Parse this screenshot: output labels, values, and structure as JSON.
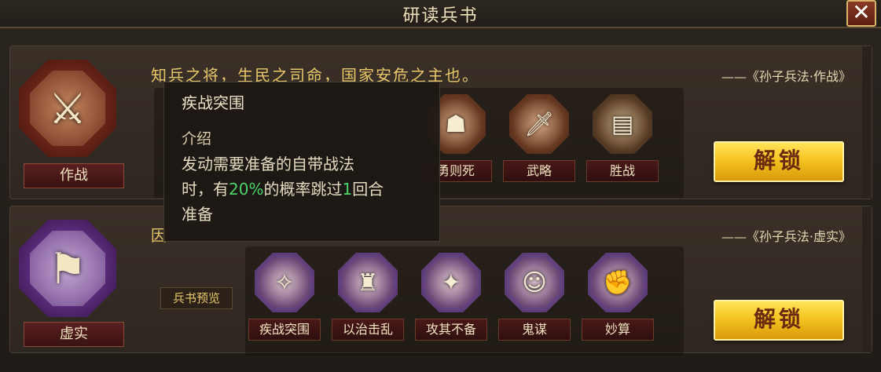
{
  "window": {
    "title": "研读兵书",
    "close_label": "✕"
  },
  "colors": {
    "accent_gold": "#f5c421",
    "highlight_green": "#4ad46a",
    "quote_gold": "#e8c86a"
  },
  "sections": [
    {
      "name": "作战",
      "emblem_icon": "crossed-swords-icon",
      "quote": "知兵之将，生民之司命，国家安危之主也。",
      "source": "——《孙子兵法·作战》",
      "unlock_label": "解锁",
      "books": [
        {
          "label": "勇则死",
          "icon": "warrior-icon"
        },
        {
          "label": "武略",
          "icon": "sword-icon"
        },
        {
          "label": "胜战",
          "icon": "scroll-icon"
        }
      ]
    },
    {
      "name": "虚实",
      "emblem_icon": "flag-icon",
      "quote": "因",
      "source": "——《孙子兵法·虚实》",
      "unlock_label": "解锁",
      "preview_label": "兵书预览",
      "books": [
        {
          "label": "疾战突围",
          "icon": "charge-icon"
        },
        {
          "label": "以治击乱",
          "icon": "general-icon"
        },
        {
          "label": "攻其不备",
          "icon": "ambush-icon"
        },
        {
          "label": "鬼谋",
          "icon": "strategist-icon"
        },
        {
          "label": "妙算",
          "icon": "fist-icon"
        }
      ]
    }
  ],
  "tooltip": {
    "title": "疾战突围",
    "section_label": "介绍",
    "line1": "发动需要准备的自带战法",
    "line2_prefix": "时，有",
    "line2_percent": "20%",
    "line2_mid": "的概率跳过",
    "line2_num": "1",
    "line2_suffix": "回合",
    "line3": "准备"
  }
}
